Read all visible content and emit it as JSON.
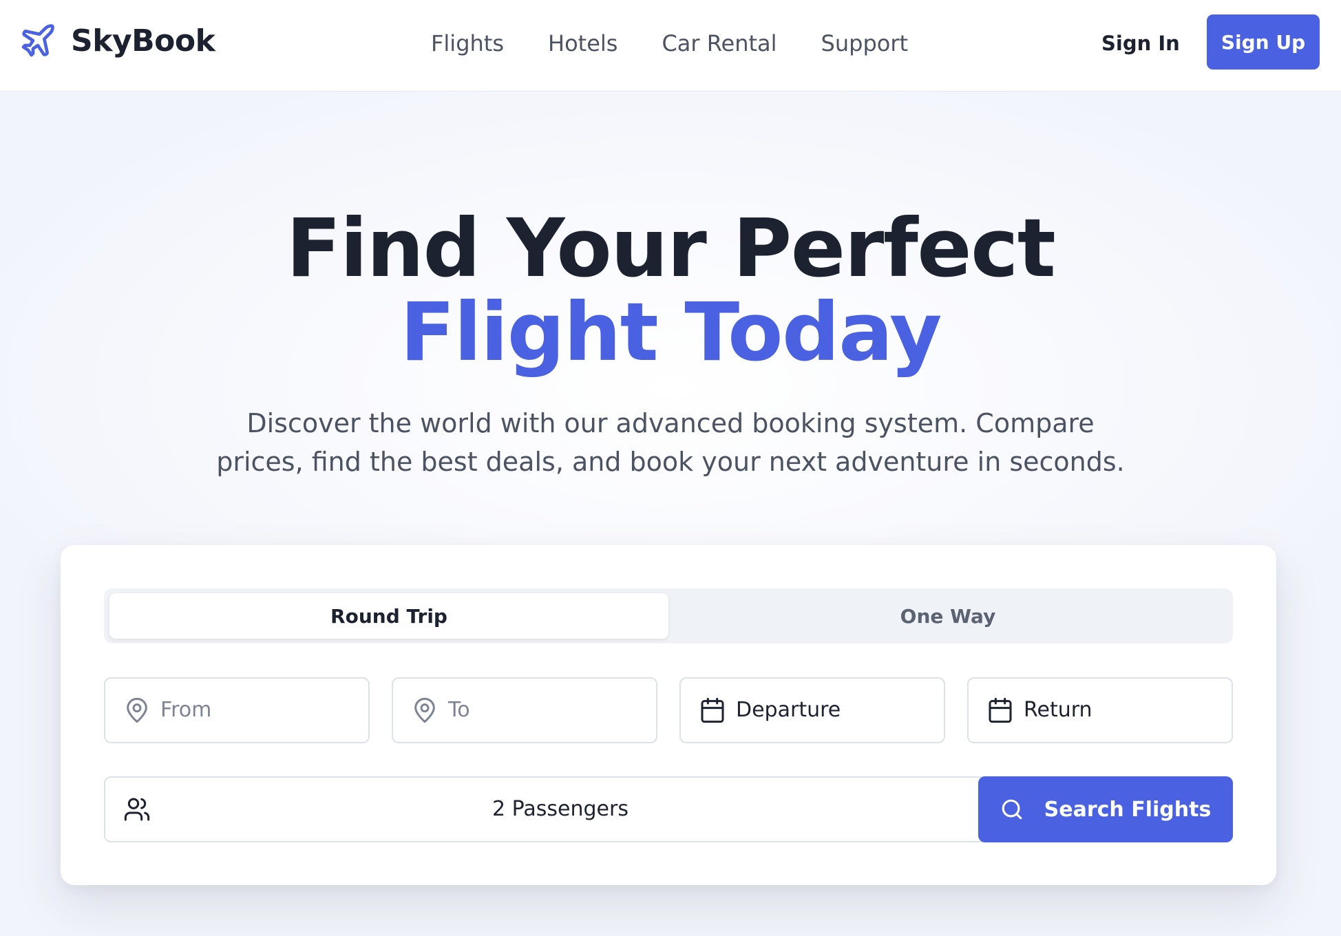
{
  "header": {
    "brand": "SkyBook",
    "nav": [
      "Flights",
      "Hotels",
      "Car Rental",
      "Support"
    ],
    "sign_in": "Sign In",
    "sign_up": "Sign Up"
  },
  "hero": {
    "title_line1": "Find Your Perfect",
    "title_line2": "Flight Today",
    "subtitle": "Discover the world with our advanced booking system. Compare prices, find the best deals, and book your next adventure in seconds."
  },
  "search": {
    "tabs": [
      "Round Trip",
      "One Way"
    ],
    "active_tab": "Round Trip",
    "from_placeholder": "From",
    "to_placeholder": "To",
    "departure": "Departure",
    "return": "Return",
    "passengers": "2 Passengers",
    "button": "Search Flights"
  },
  "colors": {
    "accent": "#4a62e1",
    "text_dark": "#1d2230",
    "text_muted": "#4b5262"
  },
  "icons": [
    "plane-icon",
    "map-pin-icon",
    "calendar-icon",
    "users-icon",
    "chevron-down-icon",
    "search-icon"
  ]
}
